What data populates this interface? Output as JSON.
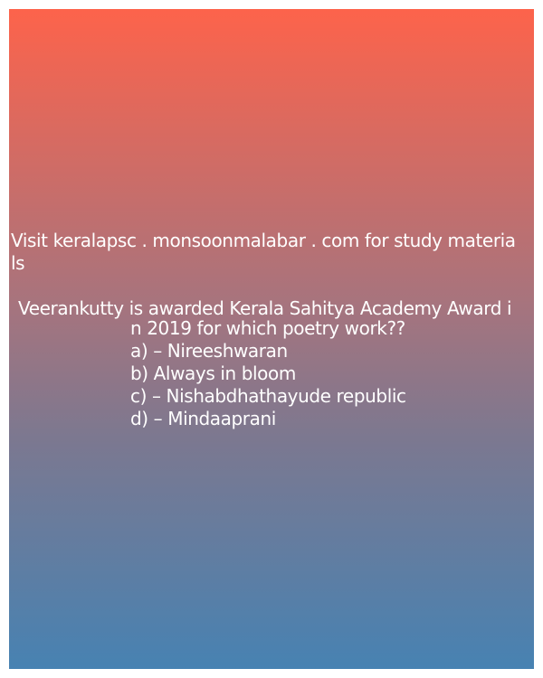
{
  "visit_line_1": "Visit keralapsc . monsoonmalabar . com for study materia",
  "visit_line_2": "ls",
  "question_line_1": "Veerankutty is awarded Kerala Sahitya Academy Award i",
  "question_line_2": "n 2019 for which poetry work??",
  "options": [
    "a) – Nireeshwaran",
    "b) Always in bloom",
    "c) – Nishabdhathayude republic",
    "d) – Mindaaprani"
  ]
}
